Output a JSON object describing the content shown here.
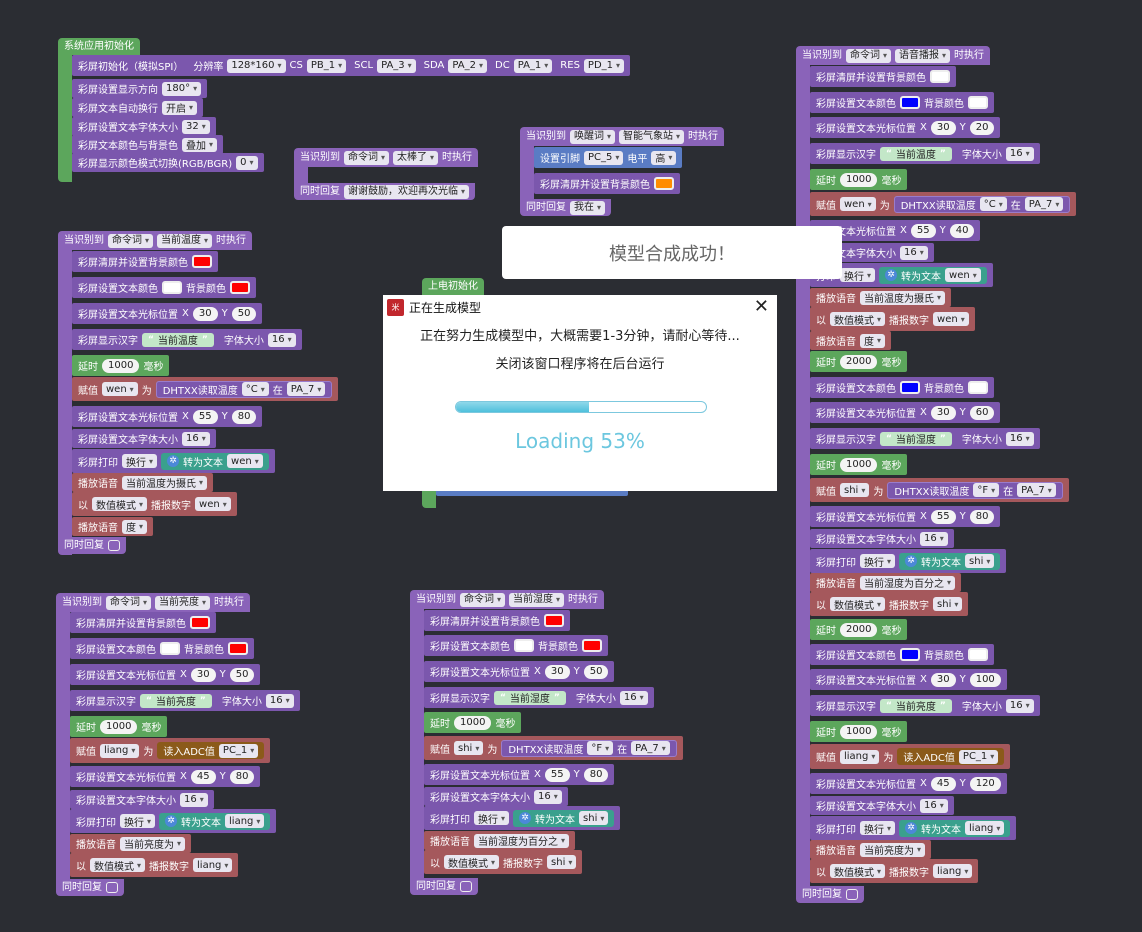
{
  "colors": {
    "bg": "#2b2d33",
    "purple": "#8a63b9",
    "green": "#5ca65c",
    "red": "#a5585c",
    "loading": "#6cc7df"
  },
  "system_group": {
    "hat": "系统应用初始化",
    "init": {
      "label": "彩屏初始化（模拟SPI）",
      "res_label": "分辨率",
      "res": "128*160",
      "cs_label": "CS",
      "cs": "PB_1",
      "scl_label": "SCL",
      "scl": "PA_3",
      "sda_label": "SDA",
      "sda": "PA_2",
      "dc_label": "DC",
      "dc": "PA_1",
      "rst_label": "RES",
      "rst": "PD_1"
    },
    "direction": {
      "label": "彩屏设置显示方向",
      "value": "180°"
    },
    "wrap": {
      "label": "彩屏文本自动换行",
      "value": "开启"
    },
    "fontsize": {
      "label": "彩屏设置文本字体大小",
      "value": "32"
    },
    "overlay": {
      "label": "彩屏文本颜色与背景色",
      "value": "叠加"
    },
    "mode": {
      "label": "彩屏显示颜色模式切换(RGB/BGR)",
      "value": "0"
    }
  },
  "thanks_group": {
    "hat": {
      "prefix": "当识别到",
      "type": "命令词",
      "word": "太棒了",
      "suffix": "时执行"
    },
    "reply_label": "同时回复",
    "reply": "谢谢鼓励，欢迎再次光临"
  },
  "wake_group": {
    "hat": {
      "prefix": "当识别到",
      "type": "唤醒词",
      "word": "智能气象站",
      "suffix": "时执行"
    },
    "pin": {
      "label": "设置引脚",
      "pin": "PC_5",
      "level_label": "电平",
      "level": "高"
    },
    "clear_label": "彩屏清屏并设置背景颜色",
    "clear_color": "#ff8c00",
    "reply_label": "同时回复",
    "reply": "我在"
  },
  "poweron_hat": "上电初始化",
  "temp_c_group": {
    "hat": {
      "prefix": "当识别到",
      "type": "命令词",
      "word": "当前温度",
      "suffix": "时执行"
    },
    "clear_label": "彩屏清屏并设置背景颜色",
    "clear_color": "#ff0000",
    "text_color_label": "彩屏设置文本颜色",
    "text_color": "#ffffff",
    "bg_label": "背景颜色",
    "bg_color": "#ff0000",
    "cursor1": {
      "label": "彩屏设置文本光标位置",
      "x_label": "X",
      "x": "30",
      "y_label": "Y",
      "y": "50"
    },
    "show_label": "彩屏显示汉字",
    "show_text": "当前温度",
    "show_size_label": "字体大小",
    "show_size": "16",
    "delay_label": "延时",
    "delay": "1000",
    "ms": "毫秒",
    "assign_label": "赋值",
    "var": "wen",
    "as": "为",
    "sensor": "DHTXX读取温度",
    "unit": "°C",
    "at": "在",
    "pin": "PA_7",
    "cursor2": {
      "label": "彩屏设置文本光标位置",
      "x_label": "X",
      "x": "55",
      "y_label": "Y",
      "y": "80"
    },
    "font_label": "彩屏设置文本字体大小",
    "font": "16",
    "print_label": "彩屏打印",
    "print_mode": "换行",
    "to_text": "转为文本",
    "print_var": "wen",
    "voice1_label": "播放语音",
    "voice1": "当前温度为摄氏",
    "num_label": "以",
    "num_mode": "数值模式",
    "num_play": "播报数字",
    "num_var": "wen",
    "voice2_label": "播放语音",
    "voice2": "度",
    "footer": "同时回复"
  },
  "light_group": {
    "hat": {
      "prefix": "当识别到",
      "type": "命令词",
      "word": "当前亮度",
      "suffix": "时执行"
    },
    "clear_label": "彩屏清屏并设置背景颜色",
    "clear_color": "#ff0000",
    "text_color_label": "彩屏设置文本颜色",
    "text_color": "#ffffff",
    "bg_label": "背景颜色",
    "bg_color": "#ff0000",
    "cursor1": {
      "label": "彩屏设置文本光标位置",
      "x_label": "X",
      "x": "30",
      "y_label": "Y",
      "y": "50"
    },
    "show_label": "彩屏显示汉字",
    "show_text": "当前亮度",
    "show_size_label": "字体大小",
    "show_size": "16",
    "delay_label": "延时",
    "delay": "1000",
    "ms": "毫秒",
    "assign_label": "赋值",
    "var": "liang",
    "as": "为",
    "adc": "读入ADC值",
    "pin": "PC_1",
    "cursor2": {
      "label": "彩屏设置文本光标位置",
      "x_label": "X",
      "x": "45",
      "y_label": "Y",
      "y": "80"
    },
    "font_label": "彩屏设置文本字体大小",
    "font": "16",
    "print_label": "彩屏打印",
    "print_mode": "换行",
    "to_text": "转为文本",
    "print_var": "liang",
    "voice_label": "播放语音",
    "voice": "当前亮度为",
    "num_label": "以",
    "num_mode": "数值模式",
    "num_play": "播报数字",
    "num_var": "liang",
    "footer": "同时回复"
  },
  "humid_group": {
    "hat": {
      "prefix": "当识别到",
      "type": "命令词",
      "word": "当前湿度",
      "suffix": "时执行"
    },
    "clear_label": "彩屏清屏并设置背景颜色",
    "clear_color": "#ff0000",
    "text_color_label": "彩屏设置文本颜色",
    "text_color": "#ffffff",
    "bg_label": "背景颜色",
    "bg_color": "#ff0000",
    "cursor1": {
      "label": "彩屏设置文本光标位置",
      "x_label": "X",
      "x": "30",
      "y_label": "Y",
      "y": "50"
    },
    "show_label": "彩屏显示汉字",
    "show_text": "当前湿度",
    "show_size_label": "字体大小",
    "show_size": "16",
    "delay_label": "延时",
    "delay": "1000",
    "ms": "毫秒",
    "assign_label": "赋值",
    "var": "shi",
    "as": "为",
    "sensor": "DHTXX读取温度",
    "unit": "°F",
    "at": "在",
    "pin": "PA_7",
    "cursor2": {
      "label": "彩屏设置文本光标位置",
      "x_label": "X",
      "x": "55",
      "y_label": "Y",
      "y": "80"
    },
    "font_label": "彩屏设置文本字体大小",
    "font": "16",
    "print_label": "彩屏打印",
    "print_mode": "换行",
    "to_text": "转为文本",
    "print_var": "shi",
    "voice_label": "播放语音",
    "voice": "当前湿度为百分之",
    "num_label": "以",
    "num_mode": "数值模式",
    "num_play": "播报数字",
    "num_var": "shi",
    "footer": "同时回复"
  },
  "voice_group": {
    "hat": {
      "prefix": "当识别到",
      "type": "命令词",
      "word": "语音播报",
      "suffix": "时执行"
    },
    "clear_label": "彩屏清屏并设置背景颜色",
    "clear_color": "#ffffff",
    "tc1": {
      "label": "彩屏设置文本颜色",
      "color": "#0000ff",
      "bg_label": "背景颜色",
      "bg": "#ffffff"
    },
    "cur1": {
      "label": "彩屏设置文本光标位置",
      "x_label": "X",
      "x": "30",
      "y_label": "Y",
      "y": "20"
    },
    "show1": {
      "label": "彩屏显示汉字",
      "text": "当前温度",
      "size_label": "字体大小",
      "size": "16"
    },
    "delay1": {
      "label": "延时",
      "value": "1000",
      "ms": "毫秒"
    },
    "assign1": {
      "label": "赋值",
      "var": "wen",
      "as": "为",
      "sensor": "DHTXX读取温度",
      "unit": "°C",
      "at": "在",
      "pin": "PA_7"
    },
    "cur2": {
      "label": "设置文本光标位置",
      "x_label": "X",
      "x": "55",
      "y_label": "Y",
      "y": "40"
    },
    "font1": {
      "label": "设置文本字体大小",
      "value": "16"
    },
    "print1": {
      "label": "打印",
      "mode": "换行",
      "to_text": "转为文本",
      "var": "wen"
    },
    "v1": {
      "label": "播放语音",
      "text": "当前温度为摄氏"
    },
    "n1": {
      "label": "以",
      "mode": "数值模式",
      "play": "播报数字",
      "var": "wen"
    },
    "v2": {
      "label": "播放语音",
      "text": "度"
    },
    "delay2": {
      "label": "延时",
      "value": "2000",
      "ms": "毫秒"
    },
    "tc2": {
      "label": "彩屏设置文本颜色",
      "color": "#0000ff",
      "bg_label": "背景颜色",
      "bg": "#ffffff"
    },
    "cur3": {
      "label": "彩屏设置文本光标位置",
      "x_label": "X",
      "x": "30",
      "y_label": "Y",
      "y": "60"
    },
    "show2": {
      "label": "彩屏显示汉字",
      "text": "当前湿度",
      "size_label": "字体大小",
      "size": "16"
    },
    "delay3": {
      "label": "延时",
      "value": "1000",
      "ms": "毫秒"
    },
    "assign2": {
      "label": "赋值",
      "var": "shi",
      "as": "为",
      "sensor": "DHTXX读取温度",
      "unit": "°F",
      "at": "在",
      "pin": "PA_7"
    },
    "cur4": {
      "label": "彩屏设置文本光标位置",
      "x_label": "X",
      "x": "55",
      "y_label": "Y",
      "y": "80"
    },
    "font2": {
      "label": "彩屏设置文本字体大小",
      "value": "16"
    },
    "print2": {
      "label": "彩屏打印",
      "mode": "换行",
      "to_text": "转为文本",
      "var": "shi"
    },
    "v3": {
      "label": "播放语音",
      "text": "当前湿度为百分之"
    },
    "n2": {
      "label": "以",
      "mode": "数值模式",
      "play": "播报数字",
      "var": "shi"
    },
    "delay4": {
      "label": "延时",
      "value": "2000",
      "ms": "毫秒"
    },
    "tc3": {
      "label": "彩屏设置文本颜色",
      "color": "#0000ff",
      "bg_label": "背景颜色",
      "bg": "#ffffff"
    },
    "cur5": {
      "label": "彩屏设置文本光标位置",
      "x_label": "X",
      "x": "30",
      "y_label": "Y",
      "y": "100"
    },
    "show3": {
      "label": "彩屏显示汉字",
      "text": "当前亮度",
      "size_label": "字体大小",
      "size": "16"
    },
    "delay5": {
      "label": "延时",
      "value": "1000",
      "ms": "毫秒"
    },
    "assign3": {
      "label": "赋值",
      "var": "liang",
      "as": "为",
      "adc": "读入ADC值",
      "pin": "PC_1"
    },
    "cur6": {
      "label": "彩屏设置文本光标位置",
      "x_label": "X",
      "x": "45",
      "y_label": "Y",
      "y": "120"
    },
    "font3": {
      "label": "彩屏设置文本字体大小",
      "value": "16"
    },
    "print3": {
      "label": "彩屏打印",
      "mode": "换行",
      "to_text": "转为文本",
      "var": "liang"
    },
    "v4": {
      "label": "播放语音",
      "text": "当前亮度为"
    },
    "n3": {
      "label": "以",
      "mode": "数值模式",
      "play": "播报数字",
      "var": "liang"
    },
    "footer": "同时回复"
  },
  "toast": "模型合成成功！",
  "dialog": {
    "title": "正在生成模型",
    "close": "✕",
    "line1": "正在努力生成模型中，大概需要1-3分钟，请耐心等待...",
    "line2": "关闭该窗口程序将在后台运行",
    "progress": 53,
    "loading": "Loading 53%"
  }
}
